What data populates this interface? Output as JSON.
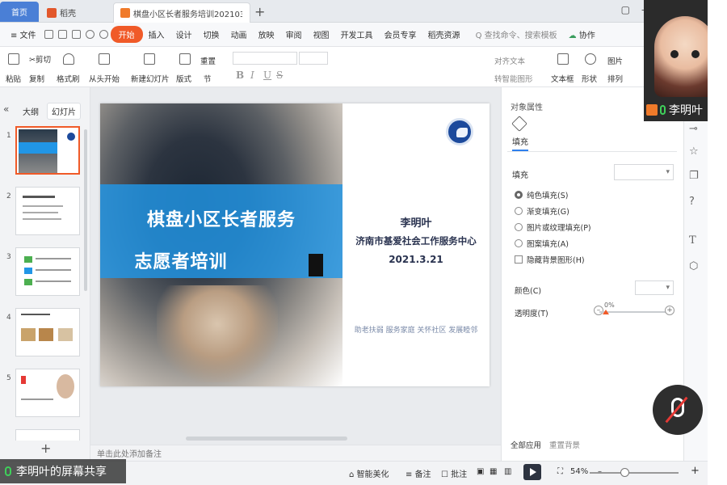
{
  "titlebar": {
    "tabs": [
      {
        "label": "首页"
      },
      {
        "label": "稻壳"
      },
      {
        "label": "棋盘小区长者服务培训20210317"
      }
    ],
    "add_tab": "+"
  },
  "menubar": {
    "file": "≡ 文件",
    "items": [
      "开始",
      "插入",
      "设计",
      "切换",
      "动画",
      "放映",
      "审阅",
      "视图",
      "开发工具",
      "会员专享",
      "稻壳资源"
    ],
    "search": "Q 查找命令、搜索模板",
    "collab": "协作"
  },
  "ribbon": {
    "paste": "粘贴",
    "cut": "剪切",
    "copy": "复制",
    "format_painter": "格式刷",
    "from_start": "从头开始",
    "new_slide": "新建幻灯片",
    "layout": "版式",
    "section": "节",
    "reset": "重置",
    "textbox": "文本框",
    "shape": "形状",
    "picture": "图片",
    "arrange": "排列",
    "align_text": "对齐文本",
    "smartart": "转智能图形",
    "bold": "B",
    "italic": "I",
    "underline": "U",
    "strike": "S"
  },
  "leftpanel": {
    "outline_tab": "大纲",
    "slides_tab": "幻灯片",
    "slide_numbers": [
      "1",
      "2",
      "3",
      "4",
      "5"
    ],
    "add": "+"
  },
  "slide": {
    "title_line1": "棋盘小区长者服务",
    "title_line2": "志愿者培训",
    "presenter": "李明叶",
    "organization": "济南市基爱社会工作服务中心",
    "date": "2021.3.21",
    "slogan": "助老扶弱 服务家庭 关怀社区 发展睦邻"
  },
  "notes": {
    "placeholder": "单击此处添加备注"
  },
  "rightpanel": {
    "title": "对象属性",
    "tab": "填充",
    "fill_label": "填充",
    "options": [
      "纯色填充(S)",
      "渐变填充(G)",
      "图片或纹理填充(P)",
      "图案填充(A)"
    ],
    "hide_bg": "隐藏背景图形(H)",
    "color_label": "颜色(C)",
    "transparency_label": "透明度(T)",
    "transparency_value": "0%",
    "apply_all": "全部应用",
    "reset_bg": "重置背景"
  },
  "statusbar": {
    "beautify": "智能美化",
    "notes": "备注",
    "comments": "批注",
    "zoom": "54%"
  },
  "overlay": {
    "share_label": "李明叶的屏幕共享",
    "participant_name": "李明叶"
  },
  "colors": {
    "accent": "#f05a28",
    "band": "#2196e6",
    "home_tab": "#4a7fd6",
    "text_dark": "#2a3350"
  }
}
